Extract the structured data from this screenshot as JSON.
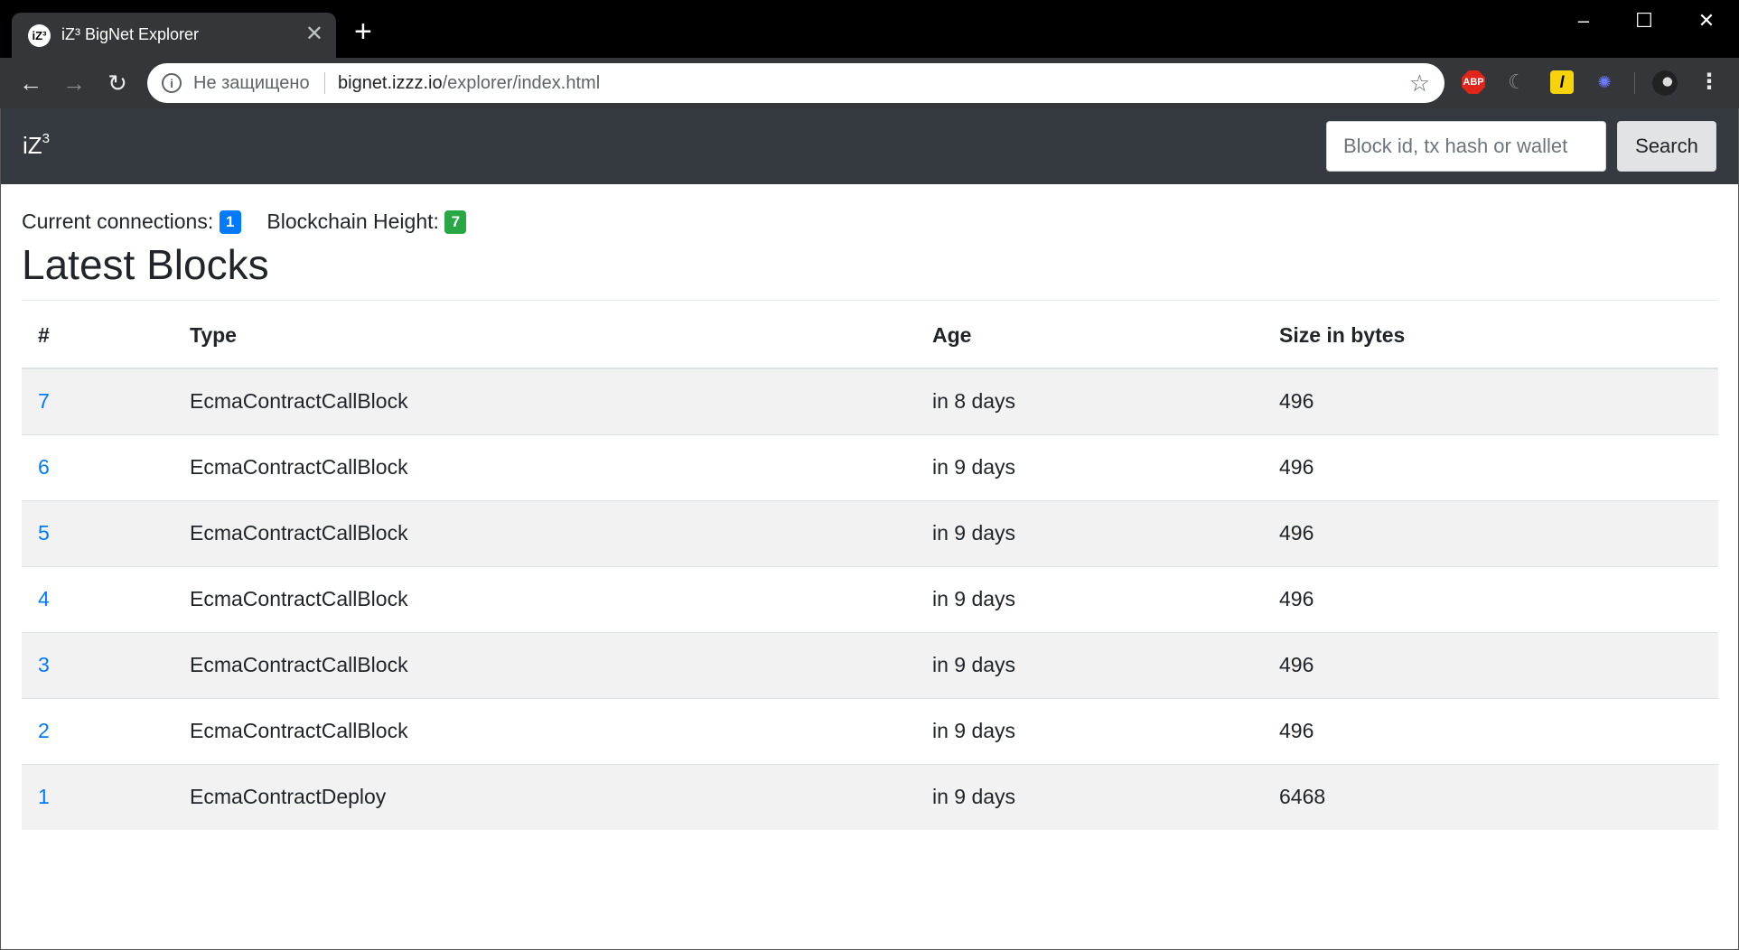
{
  "browser": {
    "tab": {
      "favicon": "iZ³",
      "title": "iZ³ BigNet Explorer"
    },
    "security_text": "Не защищено",
    "url_host": "bignet.izzz.io",
    "url_path": "/explorer/index.html",
    "extensions": {
      "abp": "ABP",
      "l": "l"
    },
    "icons": [
      "back-icon",
      "forward-icon",
      "reload-icon",
      "info-icon",
      "star-icon",
      "menu-icon",
      "close-icon",
      "plus-icon",
      "minimize-icon",
      "maximize-icon"
    ]
  },
  "navbar": {
    "brand": "iZ",
    "brand_sup": "3",
    "search_placeholder": "Block id, tx hash or wallet",
    "search_label": "Search"
  },
  "stats": {
    "connections_label": "Current connections:",
    "connections_value": "1",
    "height_label": "Blockchain Height:",
    "height_value": "7"
  },
  "main": {
    "heading": "Latest Blocks",
    "columns": [
      "#",
      "Type",
      "Age",
      "Size in bytes"
    ],
    "rows": [
      {
        "id": "7",
        "type": "EcmaContractCallBlock",
        "age": "in 8 days",
        "size": "496"
      },
      {
        "id": "6",
        "type": "EcmaContractCallBlock",
        "age": "in 9 days",
        "size": "496"
      },
      {
        "id": "5",
        "type": "EcmaContractCallBlock",
        "age": "in 9 days",
        "size": "496"
      },
      {
        "id": "4",
        "type": "EcmaContractCallBlock",
        "age": "in 9 days",
        "size": "496"
      },
      {
        "id": "3",
        "type": "EcmaContractCallBlock",
        "age": "in 9 days",
        "size": "496"
      },
      {
        "id": "2",
        "type": "EcmaContractCallBlock",
        "age": "in 9 days",
        "size": "496"
      },
      {
        "id": "1",
        "type": "EcmaContractDeploy",
        "age": "in 9 days",
        "size": "6468"
      }
    ]
  },
  "colors": {
    "navbar_bg": "#343a40",
    "link": "#007bff",
    "badge_blue": "#007bff",
    "badge_green": "#28a745",
    "stripe": "#f2f2f2"
  }
}
